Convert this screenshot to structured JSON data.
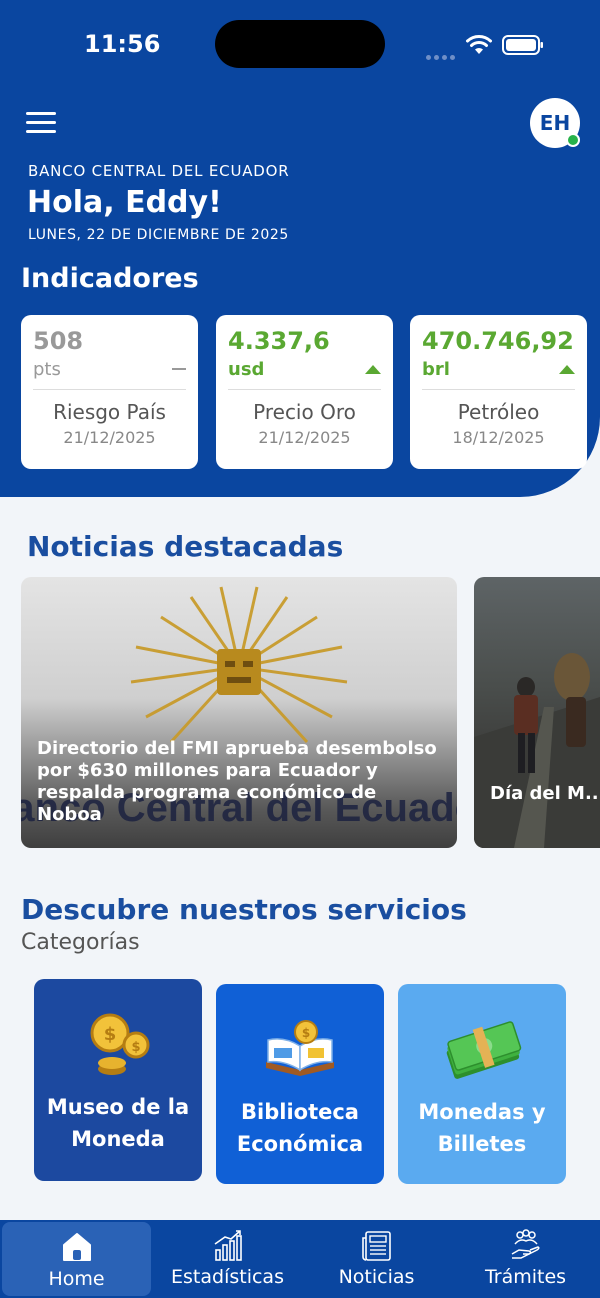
{
  "status_bar": {
    "time": "11:56"
  },
  "header": {
    "bank_name": "BANCO CENTRAL DEL ECUADOR",
    "greeting": "Hola, Eddy!",
    "date": "LUNES, 22 DE DICIEMBRE DE 2025",
    "avatar_initials": "EH"
  },
  "indicators": {
    "title": "Indicadores",
    "items": [
      {
        "value": "508",
        "unit": "pts",
        "trend": "flat",
        "name": "Riesgo País",
        "date": "21/12/2025"
      },
      {
        "value": "4.337,6",
        "unit": "usd",
        "trend": "up",
        "name": "Precio Oro",
        "date": "21/12/2025"
      },
      {
        "value": "470.746,92",
        "unit": "brl",
        "trend": "up",
        "name": "Petróleo",
        "date": "18/12/2025"
      }
    ]
  },
  "news": {
    "title": "Noticias destacadas",
    "items": [
      {
        "caption": "Directorio del FMI aprueba desembolso por $630 millones para Ecuador y respalda programa económico de Noboa",
        "image_text": "Banco Central del Ecuador"
      },
      {
        "caption": "Día del M... sostiener..."
      }
    ]
  },
  "services": {
    "title": "Descubre nuestros servicios",
    "subtitle": "Categorías",
    "items": [
      {
        "label_line1": "Museo de la",
        "label_line2": "Moneda",
        "icon": "gold-coins-icon"
      },
      {
        "label_line1": "Biblioteca",
        "label_line2": "Económica",
        "icon": "open-book-icon"
      },
      {
        "label_line1": "Monedas y",
        "label_line2": "Billetes",
        "icon": "banknotes-icon"
      }
    ]
  },
  "bottom_nav": {
    "items": [
      {
        "label": "Home",
        "icon": "home-icon",
        "active": true
      },
      {
        "label": "Estadísticas",
        "icon": "bar-chart-icon"
      },
      {
        "label": "Noticias",
        "icon": "newspaper-icon"
      },
      {
        "label": "Trámites",
        "icon": "people-hand-icon"
      }
    ]
  },
  "colors": {
    "primary": "#0a46a0",
    "accent_green": "#5aa832",
    "heading_blue": "#1a4ea0"
  }
}
